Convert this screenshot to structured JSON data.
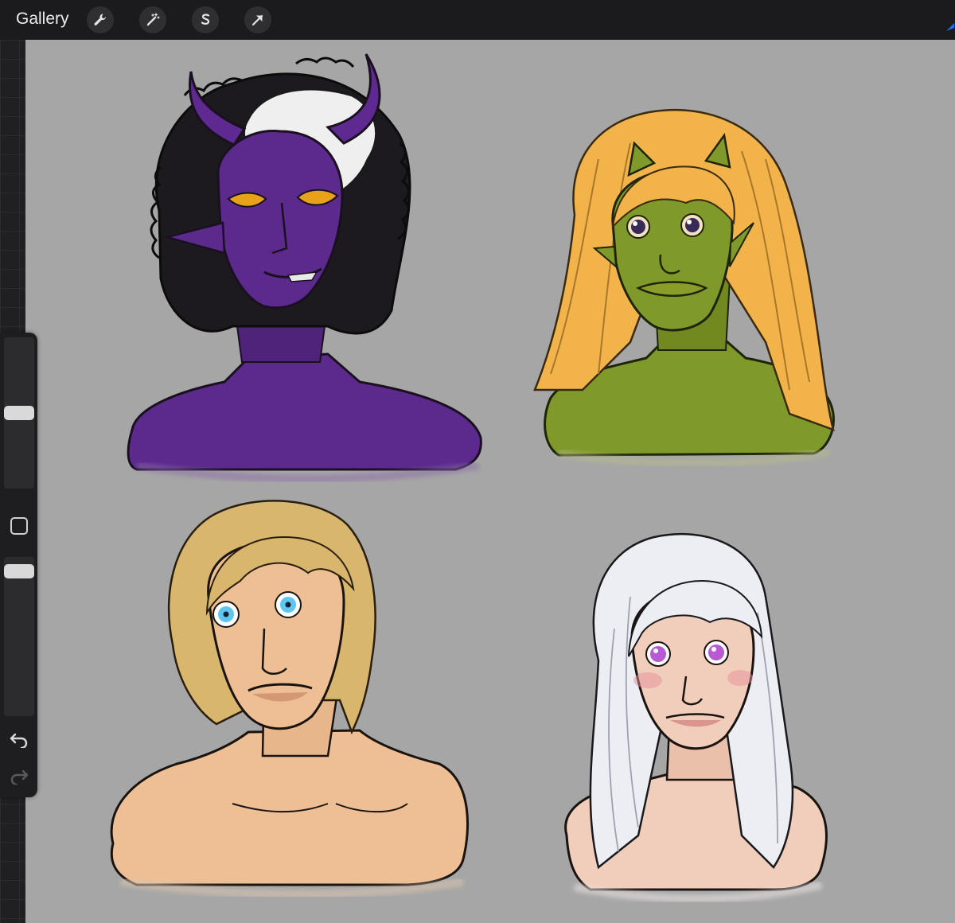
{
  "topbar": {
    "gallery_label": "Gallery",
    "tools": [
      {
        "name": "actions",
        "icon": "wrench-icon"
      },
      {
        "name": "adjustments",
        "icon": "magic-wand-icon"
      },
      {
        "name": "selection",
        "icon": "selection-s-icon"
      },
      {
        "name": "transform",
        "icon": "arrow-cursor-icon"
      }
    ],
    "accent": "#1a6ff0"
  },
  "sidebar": {
    "brush_size_level": 0.5,
    "opacity_level": 0.95,
    "modifier_icon": "square-modifier-icon",
    "undo_icon": "undo-icon",
    "redo_icon": "redo-icon"
  },
  "canvas": {
    "background": "#a6a6a6",
    "portraits": [
      {
        "name": "purple-tiefling",
        "skin": "#5b2a8c",
        "hair": "#1b1b1b",
        "accent": "#f0f0f0",
        "eyes": "#e8a21a"
      },
      {
        "name": "green-goblin",
        "skin": "#7f9a2a",
        "hair": "#f2b44a",
        "eyes": "#3a2a5a"
      },
      {
        "name": "blonde-man",
        "skin": "#eebf95",
        "hair": "#d9b66e",
        "eyes": "#5fc6f0"
      },
      {
        "name": "silver-haired-woman",
        "skin": "#f1cdbb",
        "hair": "#eceef3",
        "eyes": "#b85ad6"
      }
    ]
  }
}
